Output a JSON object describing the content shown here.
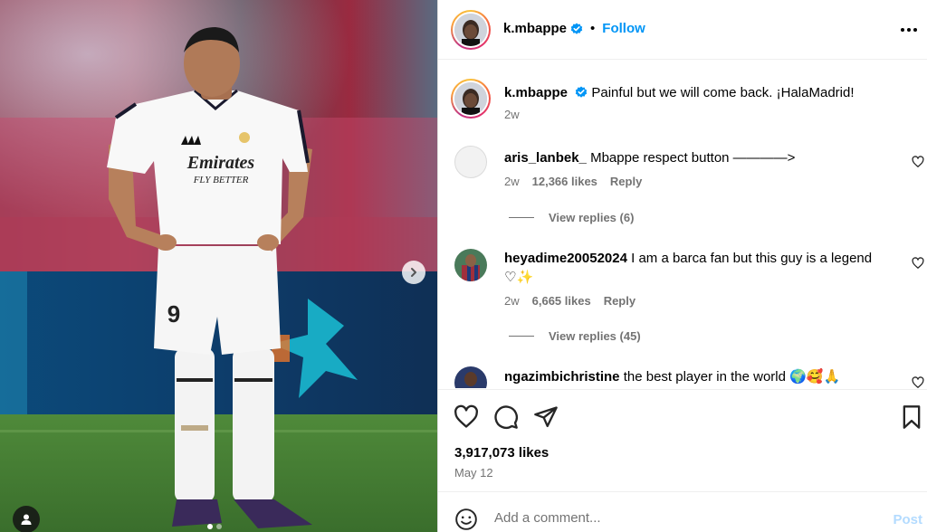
{
  "post": {
    "username": "k.mbappe",
    "follow_label": "Follow",
    "separator": "•",
    "caption": {
      "username": "k.mbappe",
      "text": "Painful but we will come back. ¡HalaMadrid!",
      "time": "2w"
    },
    "likes": "3,917,073 likes",
    "date": "May 12"
  },
  "comments": [
    {
      "username": "aris_lanbek_",
      "text": "Mbappe respect button ————>",
      "time": "2w",
      "likes": "12,366 likes",
      "reply_label": "Reply",
      "view_replies": "View replies (6)"
    },
    {
      "username": "heyadime20052024",
      "text": "I am a barca fan but this guy is a legend",
      "text_line2": "♡✨",
      "time": "2w",
      "likes": "6,665 likes",
      "reply_label": "Reply",
      "view_replies": "View replies (45)"
    },
    {
      "username": "ngazimbichristine",
      "text": "the best player in the world 🌍🥰🙏"
    }
  ],
  "add_comment": {
    "placeholder": "Add a comment...",
    "post_label": "Post"
  },
  "photo": {
    "jersey_sponsor": "Emirates",
    "jersey_sponsor_line2": "FLY BETTER",
    "shorts_number": "9"
  },
  "colors": {
    "accent": "#0095f6",
    "verified": "#0095f6",
    "muted": "#737373",
    "post_disabled": "#b3dbff"
  }
}
